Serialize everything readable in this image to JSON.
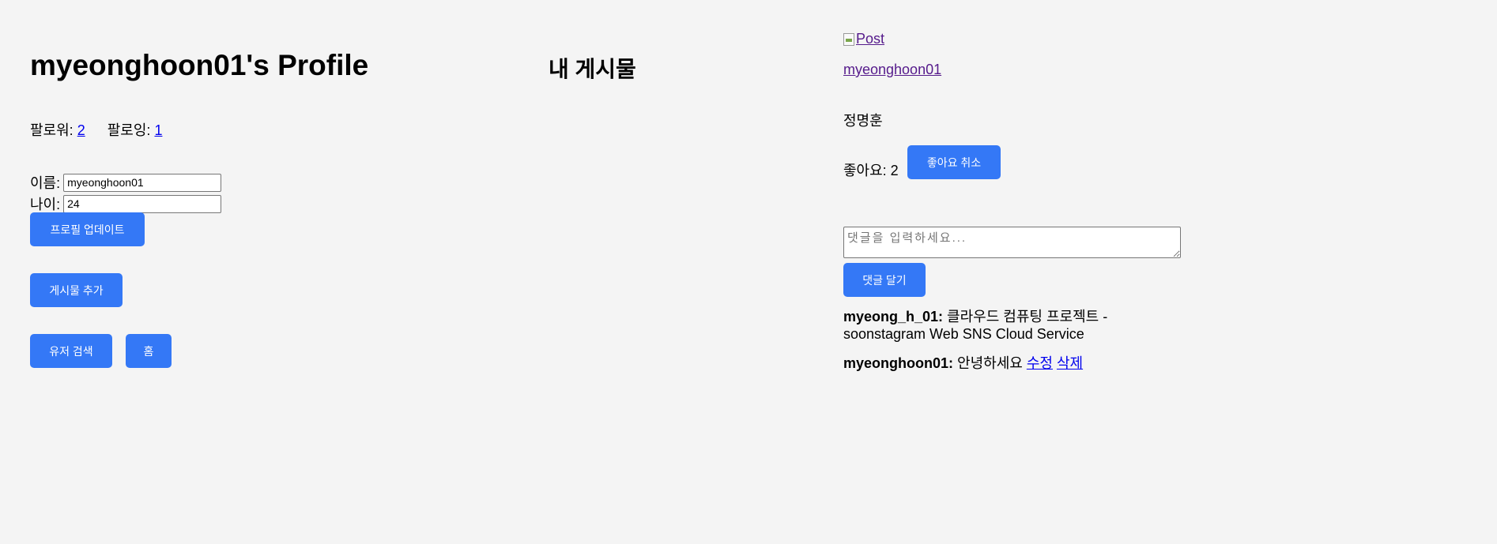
{
  "profile": {
    "title": "myeonghoon01's Profile",
    "followers_label": "팔로워:",
    "followers_count": "2",
    "following_label": "팔로잉:",
    "following_count": "1",
    "name_label": "이름:",
    "name_value": "myeonghoon01",
    "age_label": "나이:",
    "age_value": "24",
    "update_button": "프로필 업데이트",
    "add_post_button": "게시물 추가",
    "search_user_button": "유저 검색",
    "home_button": "홈"
  },
  "posts": {
    "section_title": "내 게시물"
  },
  "post": {
    "image_alt": "Post",
    "author_link": "myeonghoon01",
    "author_fullname": "정명훈",
    "likes_label": "좋아요: 2",
    "unlike_button": "좋아요 취소",
    "comment_placeholder": "댓글을 입력하세요...",
    "comment_button": "댓글 달기",
    "comments": [
      {
        "author": "myeong_h_01:",
        "text": " 클라우드 컴퓨팅 프로젝트 - soonstagram Web SNS Cloud Service"
      },
      {
        "author": "myeonghoon01:",
        "text": " 안녕하세요 ",
        "edit_label": "수정",
        "delete_label": "삭제"
      }
    ]
  },
  "colors": {
    "background": "#f4f4f4",
    "button": "#3478f6",
    "link": "#0000ee",
    "visited_link": "#551a8b"
  }
}
